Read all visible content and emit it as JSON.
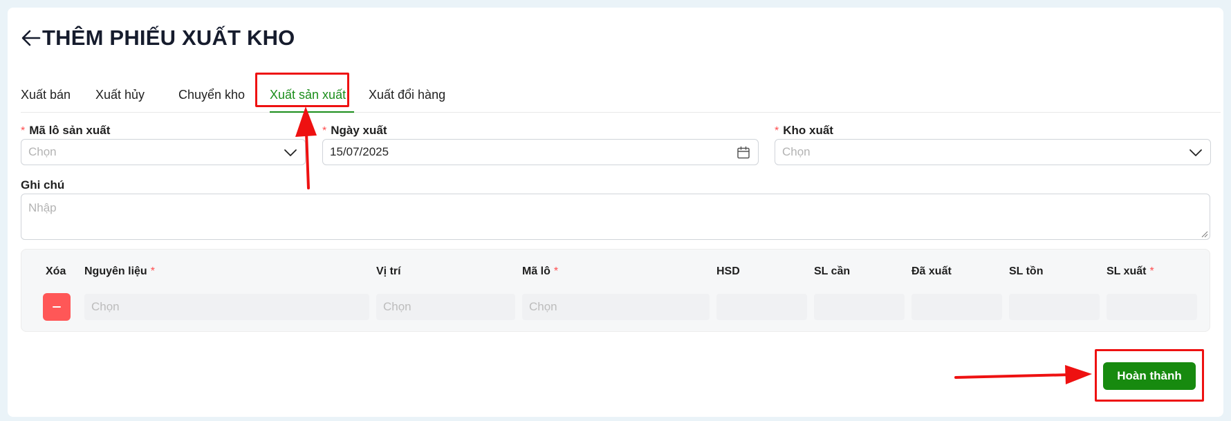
{
  "page": {
    "title": "THÊM PHIẾU XUẤT KHO",
    "back_icon": "arrow-left-icon"
  },
  "tabs": [
    {
      "label": "Xuất bán"
    },
    {
      "label": "Xuất hủy"
    },
    {
      "label": "Chuyển kho"
    },
    {
      "label": "Xuất sản xuất",
      "active": true
    },
    {
      "label": "Xuất đổi hàng"
    }
  ],
  "form": {
    "batch_code": {
      "label": "Mã lô sản xuất",
      "required": true,
      "placeholder": "Chọn"
    },
    "export_date": {
      "label": "Ngày xuất",
      "required": true,
      "value": "15/07/2025"
    },
    "warehouse": {
      "label": "Kho xuất",
      "required": true,
      "placeholder": "Chọn"
    },
    "note": {
      "label": "Ghi chú",
      "placeholder": "Nhập"
    }
  },
  "table": {
    "headers": {
      "delete": "Xóa",
      "material": "Nguyên liệu",
      "location": "Vị trí",
      "lot": "Mã lô",
      "expiry": "HSD",
      "qty_needed": "SL cần",
      "qty_exported": "Đã xuất",
      "qty_stock": "SL tồn",
      "qty_export": "SL xuất"
    },
    "required_mark": "*",
    "row": {
      "material_placeholder": "Chọn",
      "location_placeholder": "Chọn",
      "lot_placeholder": "Chọn"
    }
  },
  "actions": {
    "submit_label": "Hoàn thành"
  },
  "colors": {
    "accent": "#1a8d1a",
    "submit_bg": "#178a0f",
    "delete_bg": "#ff5757",
    "annotation": "#ee1111",
    "required": "#ff4d4f"
  }
}
